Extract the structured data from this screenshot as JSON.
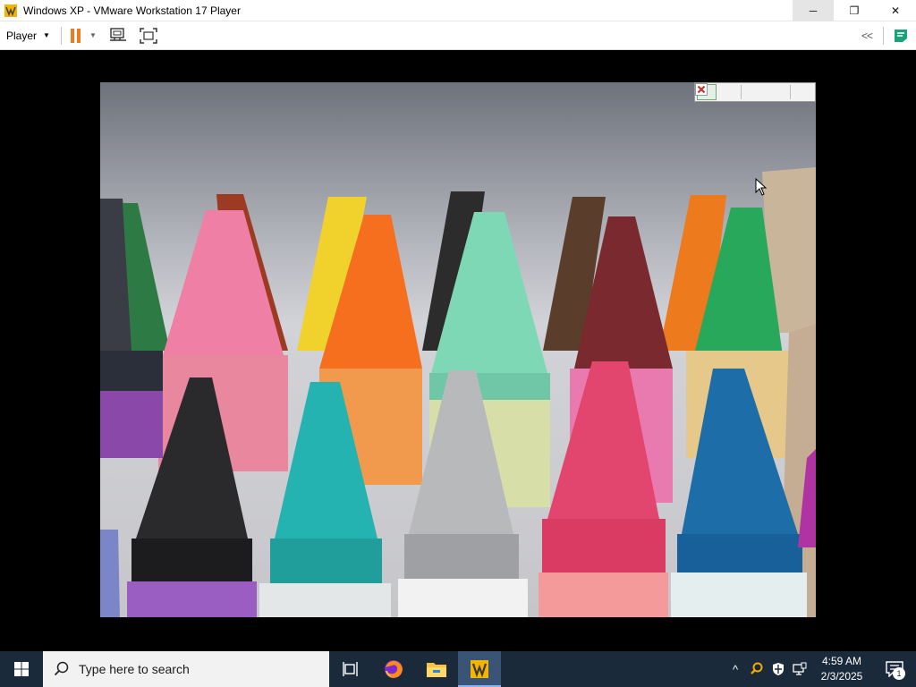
{
  "window": {
    "title": "Windows XP - VMware Workstation 17 Player",
    "minimize_glyph": "─",
    "maximize_glyph": "❐",
    "close_glyph": "✕"
  },
  "toolbar": {
    "player_label": "Player",
    "collapse_label": "<<",
    "pause_color": "#f07a22",
    "icons": [
      "pause-icon",
      "send-ctrl-alt-del-icon",
      "fullscreen-icon",
      "message-log-icon"
    ]
  },
  "viewer": {
    "content": "crayons photo in Windows Picture and Fax Viewer slideshow",
    "controls": [
      "play-icon",
      "pause-icon",
      "previous-icon",
      "next-icon",
      "close-icon"
    ]
  },
  "taskbar": {
    "search_placeholder": "Type here to search",
    "apps": [
      "task-view-icon",
      "firefox-icon",
      "file-explorer-icon",
      "vmware-player-icon"
    ],
    "active_app": "vmware-player-icon",
    "tray": {
      "chevron": "^",
      "time": "4:59 AM",
      "date": "2/3/2025",
      "notification_count": "1"
    },
    "background_color": "#1b2a3a"
  }
}
